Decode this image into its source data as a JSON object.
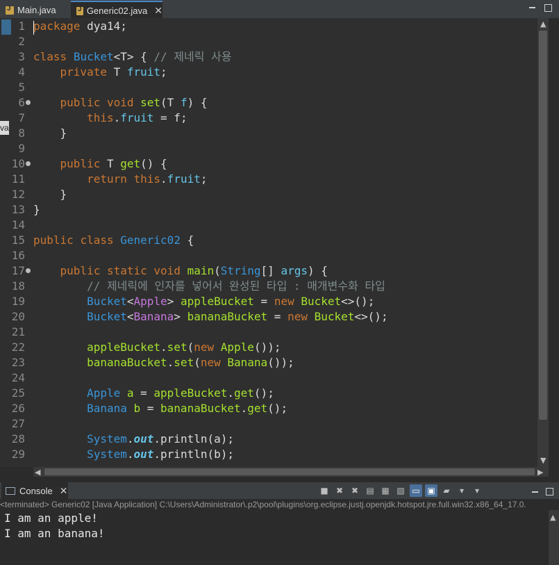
{
  "editor_tabs": [
    {
      "label": "Main.java"
    },
    {
      "label": "Generic02.java"
    }
  ],
  "tooltip": "va",
  "line_numbers": [
    "1",
    "2",
    "3",
    "4",
    "5",
    "6",
    "7",
    "8",
    "9",
    "10",
    "11",
    "12",
    "13",
    "14",
    "15",
    "16",
    "17",
    "18",
    "19",
    "20",
    "21",
    "22",
    "23",
    "24",
    "25",
    "26",
    "27",
    "28",
    "29"
  ],
  "code": {
    "l1_kw": "package",
    "l1_rest": " dya14;",
    "l3_kw": "class",
    "l3_ty": "Bucket",
    "l3_rest": "<T> { ",
    "l3_cm": "// 제네릭 사용",
    "l4_kw": "private",
    "l4_t": " T ",
    "l4_fd": "fruit",
    "l4_end": ";",
    "l6_kw1": "public",
    "l6_kw2": "void",
    "l6_fn": "set",
    "l6_a": "(T ",
    "l6_fd": "f",
    "l6_b": ") {",
    "l7_kw": "this",
    "l7_dot": ".",
    "l7_fd": "fruit",
    "l7_rest": " = f;",
    "close": "}",
    "l10_kw": "public",
    "l10_t": " T ",
    "l10_fn": "get",
    "l10_rest": "() {",
    "l11_kw": "return",
    "l11_kw2": "this",
    "l11_dot": ".",
    "l11_fd": "fruit",
    "l11_end": ";",
    "l15_kw1": "public",
    "l15_kw2": "class",
    "l15_ty": "Generic02",
    "l15_rest": " {",
    "l17_kw1": "public",
    "l17_kw2": "static",
    "l17_kw3": "void",
    "l17_fn": "main",
    "l17_p": "(",
    "l17_ty": "String",
    "l17_arr": "[] ",
    "l17_fd": "args",
    "l17_end": ") {",
    "l18_cm": "// 제네릭에 인자를 넣어서 완성된 타입 : 매개변수화 타입",
    "l19_ty": "Bucket",
    "l19_lt": "<",
    "l19_arg": "Apple",
    "l19_gt": "> ",
    "l19_var": "appleBucket",
    "l19_eq": " = ",
    "l19_new": "new",
    "l19_ty2": "Bucket",
    "l19_end": "<>();",
    "l20_ty": "Bucket",
    "l20_lt": "<",
    "l20_arg": "Banana",
    "l20_gt": "> ",
    "l20_var": "bananaBucket",
    "l20_eq": " = ",
    "l20_new": "new",
    "l20_ty2": "Bucket",
    "l20_end": "<>();",
    "l22_var": "appleBucket",
    "l22_dot": ".",
    "l22_fn": "set",
    "l22_p": "(",
    "l22_new": "new",
    "l22_ty": "Apple",
    "l22_end": "());",
    "l23_var": "bananaBucket",
    "l23_dot": ".",
    "l23_fn": "set",
    "l23_p": "(",
    "l23_new": "new",
    "l23_ty": "Banana",
    "l23_end": "());",
    "l25_ty": "Apple",
    "l25_var": " a",
    "l25_eq": " = ",
    "l25_obj": "appleBucket",
    "l25_dot": ".",
    "l25_fn": "get",
    "l25_end": "();",
    "l26_ty": "Banana",
    "l26_var": " b",
    "l26_eq": " = ",
    "l26_obj": "bananaBucket",
    "l26_dot": ".",
    "l26_fn": "get",
    "l26_end": "();",
    "l28_ty": "System",
    "l28_dot": ".",
    "l28_out": "out",
    "l28_rest": ".println(a);",
    "l29_ty": "System",
    "l29_dot": ".",
    "l29_out": "out",
    "l29_rest": ".println(b);"
  },
  "console": {
    "tab_label": "Console",
    "status": "<terminated> Generic02 [Java Application] C:\\Users\\Administrator\\.p2\\pool\\plugins\\org.eclipse.justj.openjdk.hotspot.jre.full.win32.x86_64_17.0.",
    "output": [
      "I am an apple!",
      "I am an banana!"
    ]
  }
}
